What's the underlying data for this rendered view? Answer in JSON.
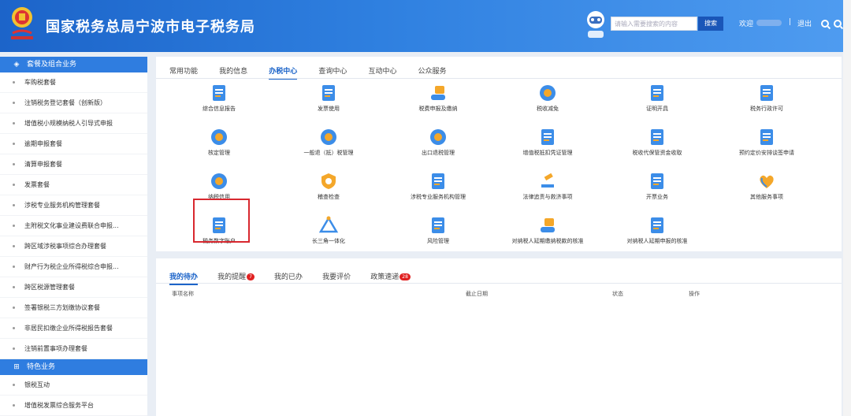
{
  "header": {
    "title": "国家税务总局宁波市电子税务局",
    "search_placeholder": "请输入需要搜索的内容",
    "search_button": "搜索",
    "welcome": "欢迎",
    "separator": "|",
    "logout": "退出"
  },
  "sidebar": {
    "section1": "套餐及组合业务",
    "items1": [
      "车购税套餐",
      "注销税务登记套餐（创新版）",
      "增值税小规模纳税人引导式申报",
      "逾期申报套餐",
      "清算申报套餐",
      "发票套餐",
      "涉税专业服务机构管理套餐",
      "主附税文化事业建设费联合申报...",
      "跨区域涉税事项综合办理套餐",
      "财产行为税企业所得税综合申报...",
      "跨区税源管理套餐",
      "签署银税三方划缴协议套餐",
      "非居民扣缴企业所得税报告套餐",
      "注销前置事项办理套餐"
    ],
    "section2": "特色业务",
    "items2": [
      "银税互动",
      "增值税发票综合服务平台"
    ]
  },
  "tabs": [
    "常用功能",
    "我的信息",
    "办税中心",
    "查询中心",
    "互动中心",
    "公众服务"
  ],
  "grid": [
    [
      "综合信息报告",
      "发票使用",
      "税费申报及缴纳",
      "税收减免",
      "证明开具",
      "税务行政许可"
    ],
    [
      "核定管理",
      "一般退（抵）税管理",
      "出口退税管理",
      "增值税抵扣凭证管理",
      "税收代保管资金收取",
      "预约定价安排谈签申请"
    ],
    [
      "纳税信用",
      "稽查检查",
      "涉税专业服务机构管理",
      "法律追责与救济事项",
      "开票业务",
      "其他服务事项"
    ],
    [
      "税务数字账户",
      "长三角一体化",
      "风险管理",
      "对纳税人延期缴纳税款的核准",
      "对纳税人延期申报的核准"
    ]
  ],
  "bottom": {
    "tabs": [
      "我的待办",
      "我的提醒",
      "我的已办",
      "我要评价",
      "政策速递"
    ],
    "badge_remind": "7",
    "badge_policy": "28",
    "columns": [
      "事项名称",
      "截止日期",
      "状态",
      "操作"
    ]
  },
  "icons": {
    "grid": [
      [
        "report-icon",
        "invoice-icon",
        "tax-declare-icon",
        "tax-reduce-icon",
        "certificate-icon",
        "license-icon"
      ],
      [
        "approve-icon",
        "refund-icon",
        "export-refund-icon",
        "vat-voucher-icon",
        "fund-icon",
        "calendar-icon"
      ],
      [
        "credit-icon",
        "inspect-icon",
        "agency-icon",
        "law-icon",
        "billing-icon",
        "heart-icon"
      ],
      [
        "digital-account-icon",
        "triangle-icon",
        "risk-icon",
        "deferred-pay-icon",
        "deferred-declare-icon"
      ]
    ]
  },
  "colors": {
    "header": "#2f80e0",
    "accent": "#1c64c9",
    "highlight": "#d8282f",
    "badge": "#e02020"
  }
}
